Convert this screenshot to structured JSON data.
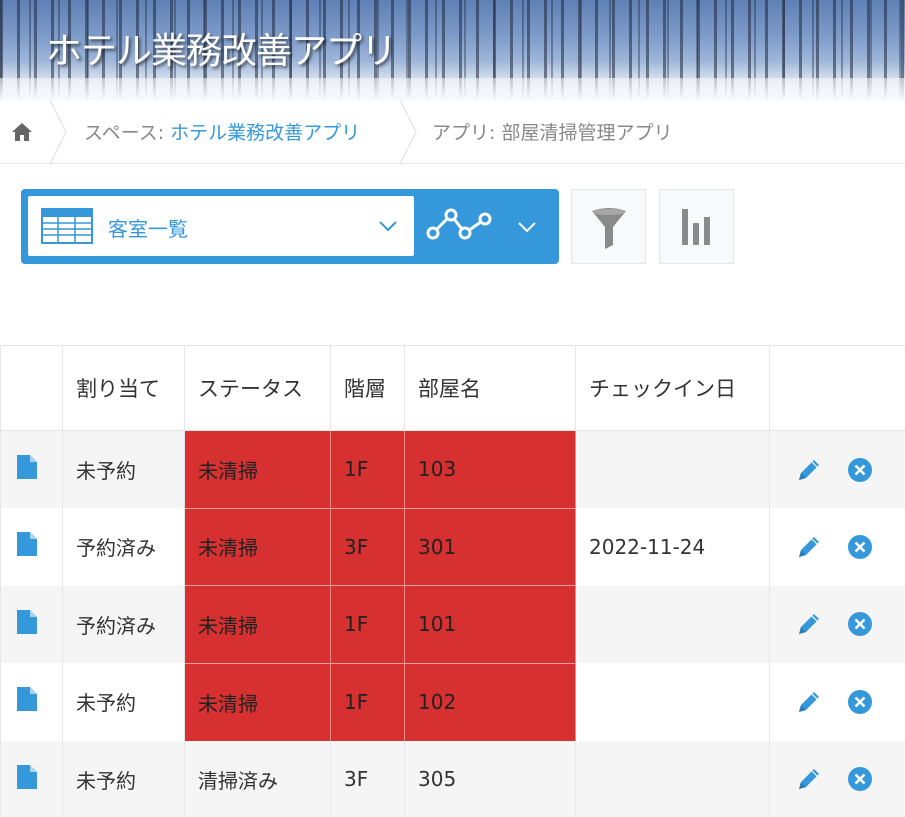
{
  "header": {
    "title": "ホテル業務改善アプリ"
  },
  "breadcrumb": {
    "space_prefix": "スペース: ",
    "space_name": "ホテル業務改善アプリ",
    "app_label": "アプリ: 部屋清掃管理アプリ"
  },
  "toolbar": {
    "view_name": "客室一覧"
  },
  "colors": {
    "accent": "#3498db",
    "highlight_red": "#d63031"
  },
  "table": {
    "headers": [
      "割り当て",
      "ステータス",
      "階層",
      "部屋名",
      "チェックイン日"
    ],
    "rows": [
      {
        "assign": "未予約",
        "status": "未清掃",
        "floor": "1F",
        "room": "103",
        "checkin": "",
        "highlight": true
      },
      {
        "assign": "予約済み",
        "status": "未清掃",
        "floor": "3F",
        "room": "301",
        "checkin": "2022-11-24",
        "highlight": true
      },
      {
        "assign": "予約済み",
        "status": "未清掃",
        "floor": "1F",
        "room": "101",
        "checkin": "",
        "highlight": true
      },
      {
        "assign": "未予約",
        "status": "未清掃",
        "floor": "1F",
        "room": "102",
        "checkin": "",
        "highlight": true
      },
      {
        "assign": "未予約",
        "status": "清掃済み",
        "floor": "3F",
        "room": "305",
        "checkin": "",
        "highlight": false
      }
    ]
  }
}
